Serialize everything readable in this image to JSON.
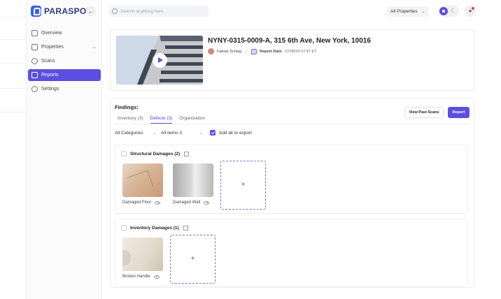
{
  "brand": {
    "name": "PARASPOT",
    "accent": "#5b4fe0",
    "logo_color": "#3b63e0"
  },
  "sidebar": {
    "collapse_icon": "arrow-left-icon",
    "items": [
      {
        "label": "Overview",
        "icon": "dashboard-icon",
        "active": false
      },
      {
        "label": "Properties",
        "icon": "building-icon",
        "active": false,
        "expandable": true
      },
      {
        "label": "Scans",
        "icon": "scan-icon",
        "active": false
      },
      {
        "label": "Reports",
        "icon": "report-icon",
        "active": true
      },
      {
        "label": "Settings",
        "icon": "gear-icon",
        "active": false
      }
    ]
  },
  "header": {
    "search_placeholder": "Search anything here",
    "properties_filter": "All Properties",
    "theme_toggle": {
      "light_icon": "sun-icon",
      "dark_icon": "moon-icon",
      "mode": "light"
    },
    "notification_icon": "bell-icon"
  },
  "property": {
    "title": "NYNY-0315-0009-A, 315 6th Ave, New York, 10016",
    "author": "Fabian Schlag",
    "report_date_label": "Report Date:",
    "report_date": "07/05/24 07:47 ET"
  },
  "findings": {
    "title": "Findings:",
    "tabs": [
      {
        "label": "Inventory (3)",
        "active": false
      },
      {
        "label": "Defects (3)",
        "active": true
      },
      {
        "label": "Organization",
        "active": false
      }
    ],
    "view_past_scans": "View Past Scans",
    "report_button": "Report",
    "filters": {
      "category": "All Categories",
      "items": "All items 3",
      "add_all_label": "Add all to export",
      "add_all_checked": true
    },
    "groups": [
      {
        "title": "Structural Damages (2)",
        "items": [
          {
            "caption": "Damaged Floor"
          },
          {
            "caption": "Damaged Wall"
          }
        ],
        "add_symbol": "+"
      },
      {
        "title": "Inventory Damages (1)",
        "items": [
          {
            "caption": "Broken Handle"
          }
        ],
        "add_symbol": "+"
      }
    ]
  }
}
